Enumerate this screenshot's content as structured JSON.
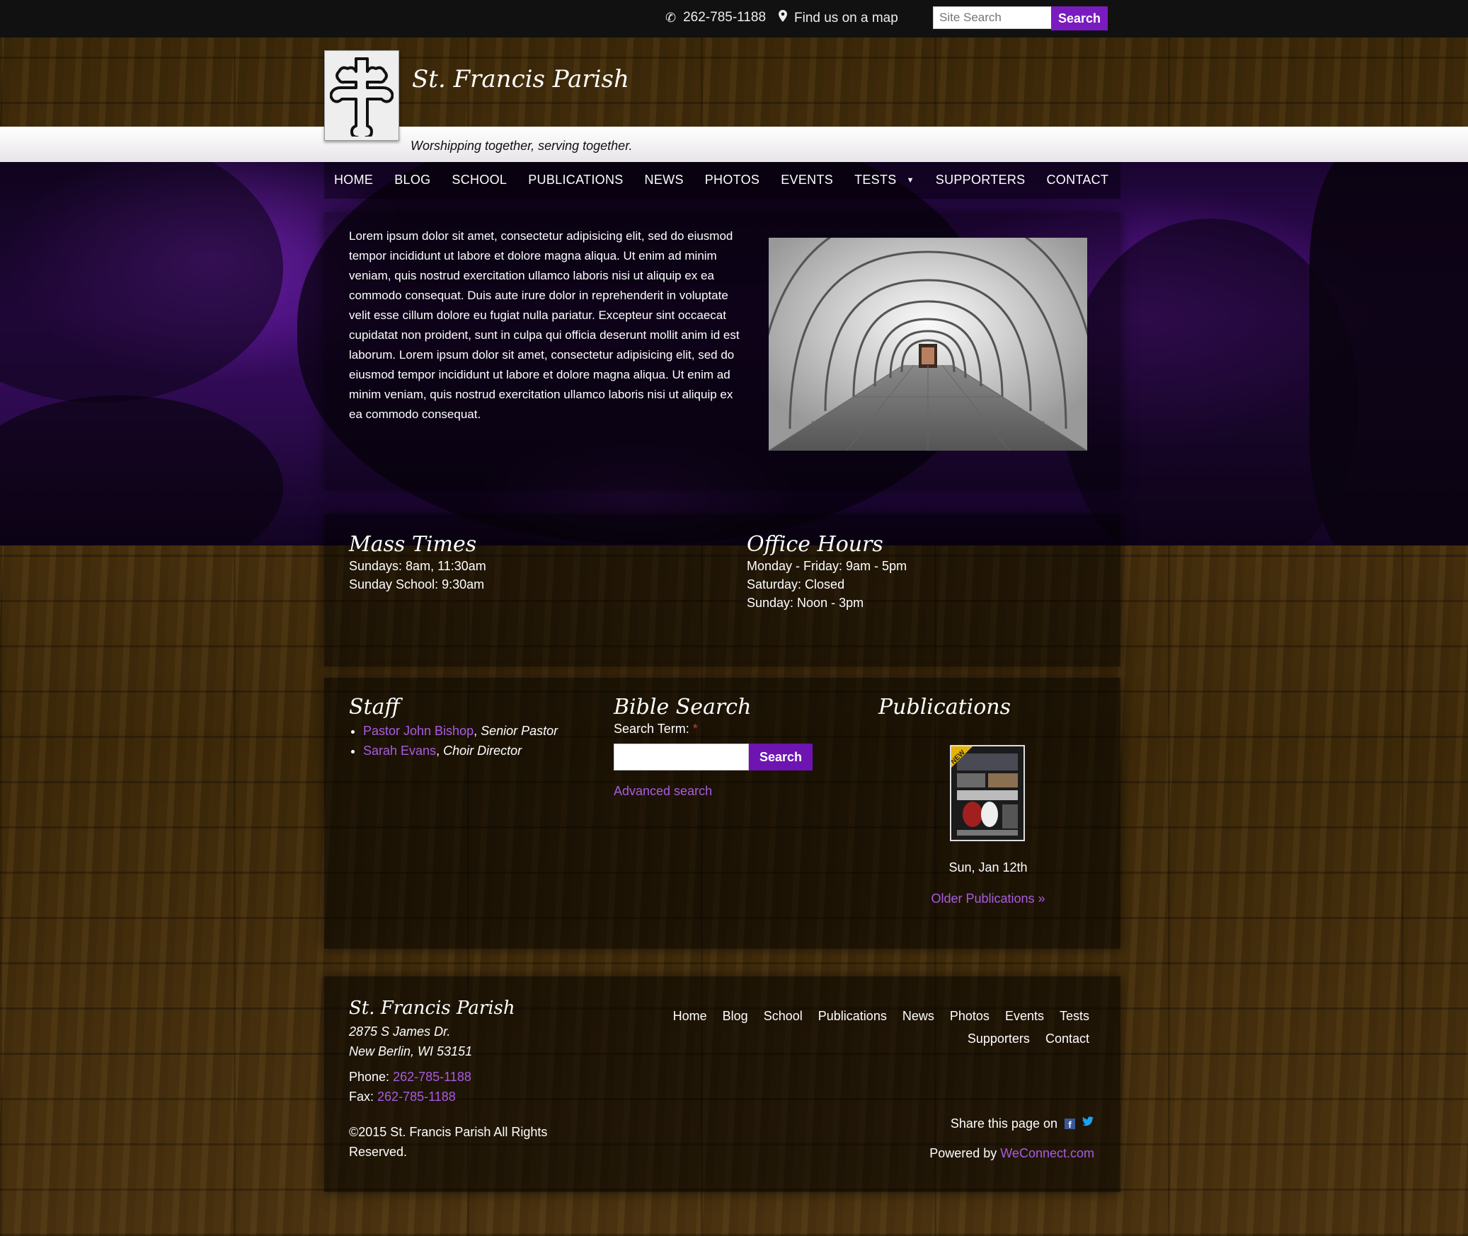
{
  "topbar": {
    "phone": "262-785-1188",
    "map_label": "Find us on a map",
    "search_placeholder": "Site Search",
    "search_button": "Search"
  },
  "header": {
    "title": "St. Francis Parish",
    "tagline": "Worshipping together, serving together."
  },
  "nav": {
    "items": [
      "HOME",
      "BLOG",
      "SCHOOL",
      "PUBLICATIONS",
      "NEWS",
      "PHOTOS",
      "EVENTS",
      "TESTS",
      "SUPPORTERS",
      "CONTACT"
    ]
  },
  "intro": {
    "text": "Lorem ipsum dolor sit amet, consectetur adipisicing elit, sed do eiusmod tempor incididunt ut labore et dolore magna aliqua. Ut enim ad minim veniam, quis nostrud exercitation ullamco laboris nisi ut aliquip ex ea commodo consequat. Duis aute irure dolor in reprehenderit in voluptate velit esse cillum dolore eu fugiat nulla pariatur. Excepteur sint occaecat cupidatat non proident, sunt in culpa qui officia deserunt mollit anim id est laborum. Lorem ipsum dolor sit amet, consectetur adipisicing elit, sed do eiusmod tempor incididunt ut labore et dolore magna aliqua. Ut enim ad minim veniam, quis nostrud exercitation ullamco laboris nisi ut aliquip ex ea commodo consequat."
  },
  "mass": {
    "title": "Mass Times",
    "lines": [
      "Sundays: 8am, 11:30am",
      "Sunday School: 9:30am"
    ]
  },
  "office": {
    "title": "Office Hours",
    "lines": [
      "Monday - Friday: 9am - 5pm",
      "Saturday: Closed",
      "Sunday: Noon - 3pm"
    ]
  },
  "staff": {
    "title": "Staff",
    "members": [
      {
        "name": "Pastor John Bishop",
        "role": "Senior Pastor"
      },
      {
        "name": "Sarah Evans",
        "role": "Choir Director"
      }
    ]
  },
  "bible": {
    "title": "Bible Search",
    "label": "Search Term:",
    "required": "*",
    "button": "Search",
    "advanced": "Advanced search"
  },
  "publications": {
    "title": "Publications",
    "badge": "NEW",
    "date": "Sun, Jan 12th",
    "older": "Older Publications »"
  },
  "footer": {
    "title": "St. Francis Parish",
    "address1": "2875 S James Dr.",
    "address2": "New Berlin, WI 53151",
    "phone_label": "Phone:",
    "phone": "262-785-1188",
    "fax_label": "Fax:",
    "fax": "262-785-1188",
    "copyright1": "©2015 St. Francis Parish All Rights",
    "copyright2": "Reserved.",
    "nav": [
      "Home",
      "Blog",
      "School",
      "Publications",
      "News",
      "Photos",
      "Events",
      "Tests",
      "Supporters",
      "Contact"
    ],
    "share": "Share this page on",
    "powered": "Powered by",
    "powered_link": "WeConnect.com"
  },
  "colors": {
    "accent": "#7a1bc0",
    "link": "#a95ce0",
    "topbar": "#111111"
  }
}
